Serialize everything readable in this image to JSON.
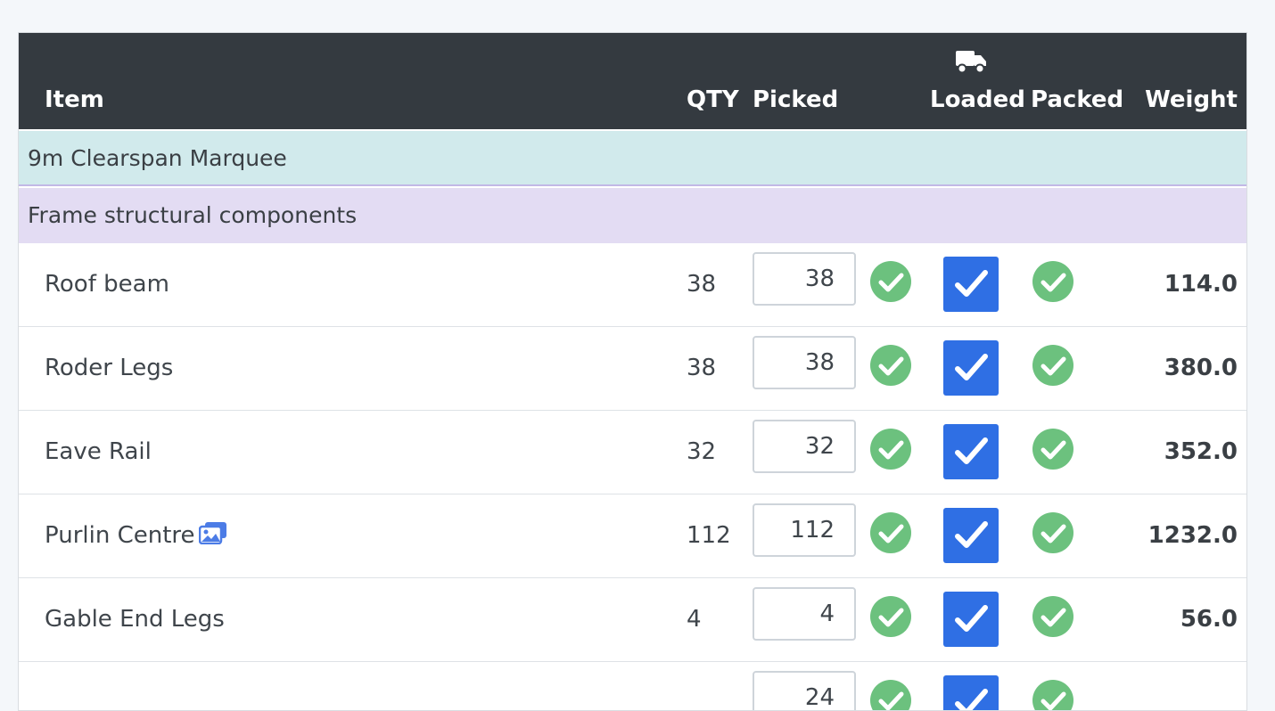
{
  "header": {
    "item": "Item",
    "qty": "QTY",
    "picked": "Picked",
    "loaded": "Loaded",
    "packed": "Packed",
    "weight": "Weight",
    "loaded_icon": "truck-icon"
  },
  "groups": {
    "main": "9m Clearspan Marquee",
    "sub": "Frame structural components"
  },
  "rows": [
    {
      "item": "Roof beam",
      "qty": "38",
      "picked": "38",
      "weight": "114.0",
      "has_image": false,
      "picked_ok": true,
      "loaded": true,
      "packed_ok": true
    },
    {
      "item": "Roder Legs",
      "qty": "38",
      "picked": "38",
      "weight": "380.0",
      "has_image": false,
      "picked_ok": true,
      "loaded": true,
      "packed_ok": true
    },
    {
      "item": "Eave Rail",
      "qty": "32",
      "picked": "32",
      "weight": "352.0",
      "has_image": false,
      "picked_ok": true,
      "loaded": true,
      "packed_ok": true
    },
    {
      "item": "Purlin Centre",
      "qty": "112",
      "picked": "112",
      "weight": "1232.0",
      "has_image": true,
      "picked_ok": true,
      "loaded": true,
      "packed_ok": true
    },
    {
      "item": "Gable End Legs",
      "qty": "4",
      "picked": "4",
      "weight": "56.0",
      "has_image": false,
      "picked_ok": true,
      "loaded": true,
      "packed_ok": true
    },
    {
      "item": "",
      "qty": "",
      "picked": "24",
      "weight": "",
      "has_image": false,
      "picked_ok": true,
      "loaded": true,
      "packed_ok": true
    }
  ],
  "colors": {
    "header_bg": "#343a40",
    "group_bg": "#d1eaec",
    "subgroup_bg": "#e3dcf3",
    "check_green": "#6cc17e",
    "loaded_blue": "#2f6fe4",
    "image_icon": "#4c7ce6"
  }
}
